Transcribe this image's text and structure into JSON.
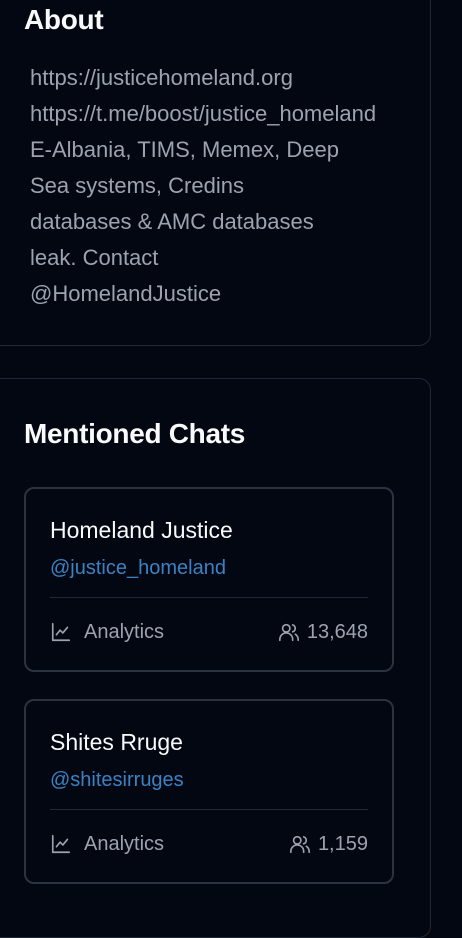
{
  "about": {
    "title": "About",
    "lines": [
      "https://justicehomeland.org",
      "https://t.me/boost/justice_homeland",
      "E-Albania, TIMS, Memex, Deep",
      "Sea systems, Credins",
      "databases & AMC databases",
      "leak. Contact",
      "@HomelandJustice"
    ]
  },
  "mentioned_chats": {
    "title": "Mentioned Chats",
    "chats": [
      {
        "name": "Homeland Justice",
        "handle": "@justice_homeland",
        "analytics_label": "Analytics",
        "members": "13,648"
      },
      {
        "name": "Shites Rruge",
        "handle": "@shitesirruges",
        "analytics_label": "Analytics",
        "members": "1,159"
      }
    ]
  },
  "colors": {
    "background": "#030712",
    "card_border": "#1f2937",
    "link": "#3b82c4",
    "muted_text": "#9ca3af"
  }
}
